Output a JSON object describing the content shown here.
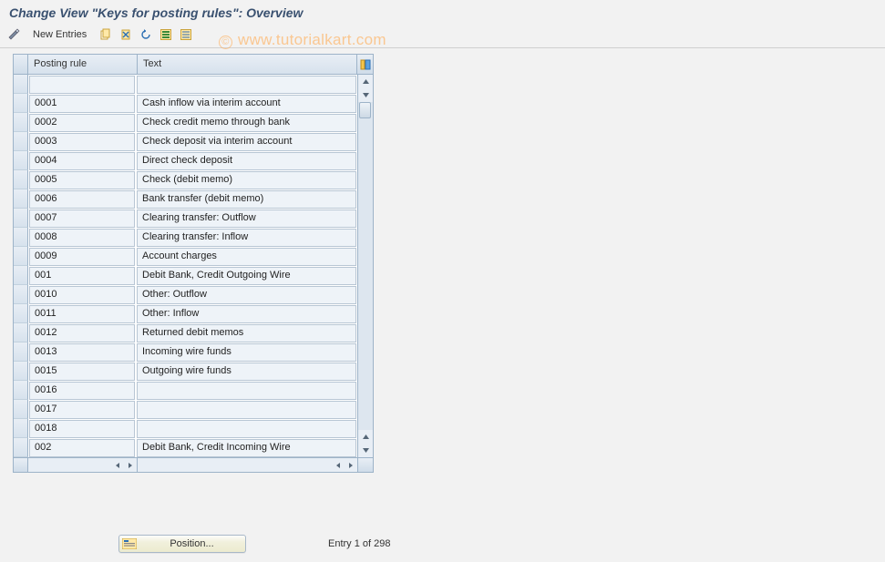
{
  "title": "Change View \"Keys for posting rules\": Overview",
  "toolbar": {
    "new_entries_label": "New Entries"
  },
  "watermark": "www.tutorialkart.com",
  "columns": {
    "rule": "Posting rule",
    "text": "Text"
  },
  "rows": [
    {
      "rule": "",
      "text": ""
    },
    {
      "rule": "0001",
      "text": "Cash inflow via interim account"
    },
    {
      "rule": "0002",
      "text": "Check credit memo through bank"
    },
    {
      "rule": "0003",
      "text": "Check deposit via interim account"
    },
    {
      "rule": "0004",
      "text": "Direct check deposit"
    },
    {
      "rule": "0005",
      "text": "Check (debit memo)"
    },
    {
      "rule": "0006",
      "text": "Bank transfer (debit memo)"
    },
    {
      "rule": "0007",
      "text": "Clearing transfer: Outflow"
    },
    {
      "rule": "0008",
      "text": "Clearing transfer: Inflow"
    },
    {
      "rule": "0009",
      "text": "Account charges"
    },
    {
      "rule": "001",
      "text": "Debit Bank, Credit Outgoing Wire"
    },
    {
      "rule": "0010",
      "text": "Other: Outflow"
    },
    {
      "rule": "0011",
      "text": "Other: Inflow"
    },
    {
      "rule": "0012",
      "text": "Returned debit memos"
    },
    {
      "rule": "0013",
      "text": "Incoming wire funds"
    },
    {
      "rule": "0015",
      "text": "Outgoing wire funds"
    },
    {
      "rule": "0016",
      "text": ""
    },
    {
      "rule": "0017",
      "text": ""
    },
    {
      "rule": "0018",
      "text": ""
    },
    {
      "rule": "002",
      "text": "Debit Bank, Credit Incoming Wire"
    }
  ],
  "footer": {
    "position_label": "Position...",
    "entry_info": "Entry 1 of 298"
  }
}
